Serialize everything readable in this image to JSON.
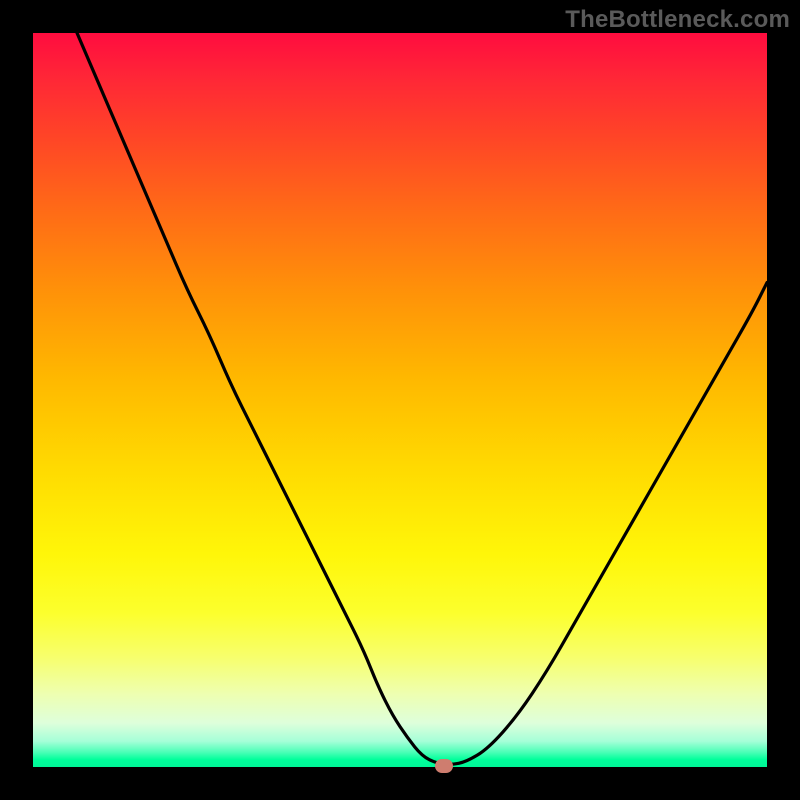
{
  "watermark": "TheBottleneck.com",
  "colors": {
    "frame": "#000000",
    "curve": "#000000",
    "marker": "#ce7d6f"
  },
  "chart_data": {
    "type": "line",
    "title": "",
    "xlabel": "",
    "ylabel": "",
    "xlim": [
      0,
      100
    ],
    "ylim": [
      0,
      100
    ],
    "grid": false,
    "legend": false,
    "annotations": [
      "TheBottleneck.com"
    ],
    "series": [
      {
        "name": "bottleneck-curve",
        "x": [
          6,
          9,
          12,
          15,
          18,
          21,
          24,
          27,
          30,
          33,
          36,
          39,
          42,
          45,
          47,
          49,
          51,
          53,
          55,
          57,
          59,
          62,
          66,
          70,
          74,
          78,
          82,
          86,
          90,
          94,
          98,
          100
        ],
        "y": [
          100,
          93,
          86,
          79,
          72,
          65,
          59,
          52,
          46,
          40,
          34,
          28,
          22,
          16,
          11,
          7,
          4,
          1.5,
          0.5,
          0.3,
          0.7,
          2.5,
          7,
          13,
          20,
          27,
          34,
          41,
          48,
          55,
          62,
          66
        ]
      }
    ],
    "marker": {
      "x": 56,
      "y": 0.2
    },
    "gradient_stops": [
      {
        "pct": 0,
        "color": "#ff0c3f"
      },
      {
        "pct": 35,
        "color": "#ff9109"
      },
      {
        "pct": 60,
        "color": "#ffdc01"
      },
      {
        "pct": 85,
        "color": "#f7ff6c"
      },
      {
        "pct": 100,
        "color": "#00f697"
      }
    ]
  }
}
